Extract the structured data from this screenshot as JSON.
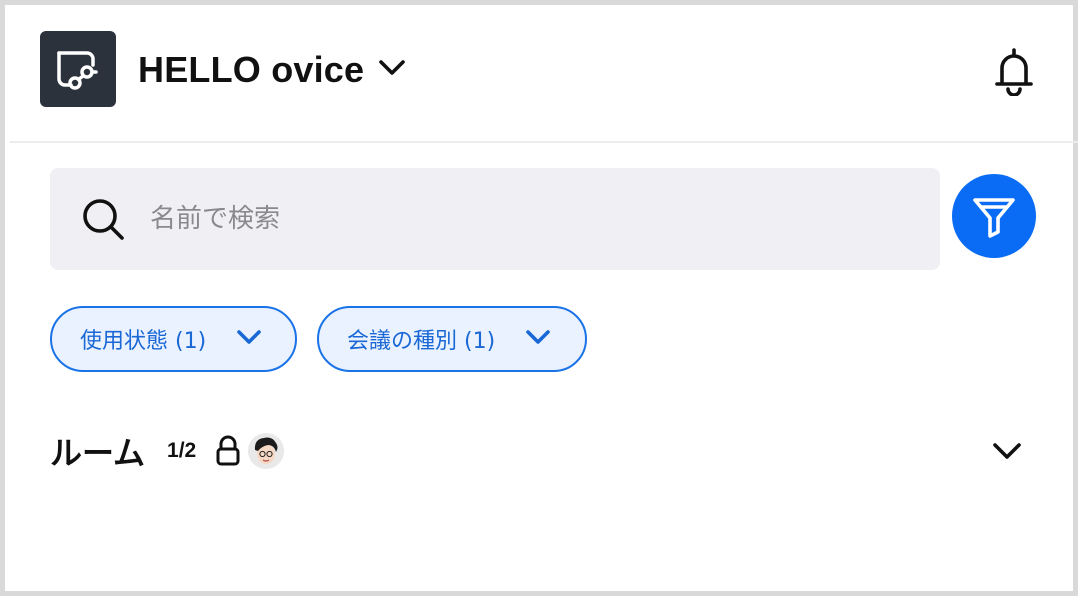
{
  "header": {
    "workspace_name": "HELLO ovice",
    "logo_icon": "ovice-logo-icon",
    "notification_icon": "bell-icon"
  },
  "search": {
    "placeholder": "名前で検索",
    "value": ""
  },
  "filter_button": {
    "icon": "funnel-icon",
    "color": "#0a6cf5"
  },
  "chips": [
    {
      "label": "使用状態 (1)",
      "icon": "chevron-down-icon"
    },
    {
      "label": "会議の種別 (1)",
      "icon": "chevron-down-icon"
    }
  ],
  "room": {
    "title": "ルーム",
    "count": "1/2",
    "lock_icon": "lock-icon",
    "expand_icon": "chevron-down-icon"
  },
  "colors": {
    "accent": "#0a6cf5",
    "chip_border": "#1a73e8",
    "chip_bg": "#e9f2fe",
    "search_bg": "#f0eff4",
    "logo_bg": "#2b323c"
  }
}
